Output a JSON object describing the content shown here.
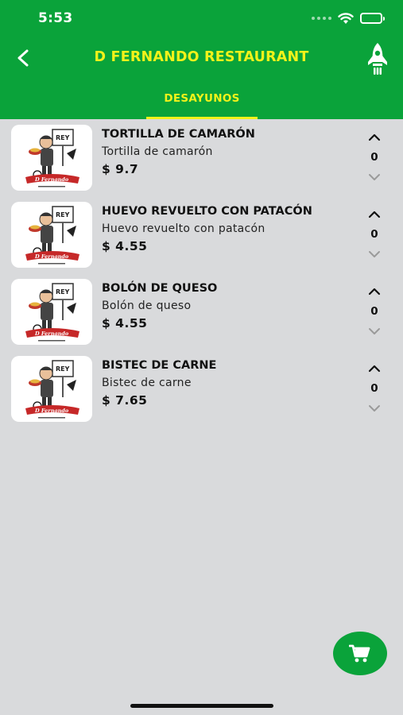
{
  "status_bar": {
    "time": "5:53"
  },
  "header": {
    "title": "D FERNANDO RESTAURANT",
    "brand_color": "#0aa33a",
    "accent_color": "#f2f21a"
  },
  "tabs": [
    {
      "label": "DESAYUNOS",
      "selected": true
    }
  ],
  "items": [
    {
      "name": "TORTILLA DE CAMARÓN",
      "description": "Tortilla de camarón",
      "price": "$ 9.7",
      "quantity": "0"
    },
    {
      "name": "HUEVO REVUELTO CON PATACÓN",
      "description": "Huevo revuelto con patacón",
      "price": "$ 4.55",
      "quantity": "0"
    },
    {
      "name": "BOLÓN DE QUESO",
      "description": "Bolón de queso",
      "price": "$ 4.55",
      "quantity": "0"
    },
    {
      "name": "BISTEC DE CARNE",
      "description": "Bistec de carne",
      "price": "$ 7.65",
      "quantity": "0"
    }
  ],
  "logo": {
    "sign_text": "REY",
    "brand_text": "D Fernando"
  },
  "icons": {
    "back": "chevron-left-icon",
    "rocket": "rocket-icon",
    "cart": "cart-icon",
    "qty_up": "chevron-up-icon",
    "qty_down": "chevron-down-icon"
  }
}
